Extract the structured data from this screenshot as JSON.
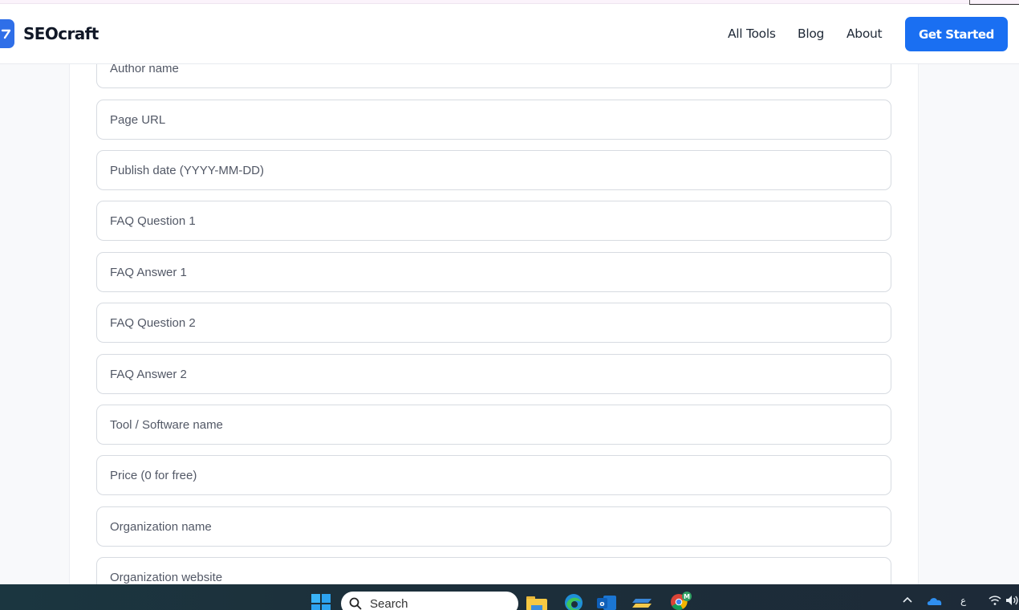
{
  "header": {
    "brand": "SEOcraft",
    "nav": [
      "All Tools",
      "Blog",
      "About"
    ],
    "cta_label": "Get Started"
  },
  "form": {
    "placeholders": [
      "Author name",
      "Page URL",
      "Publish date (YYYY-MM-DD)",
      "FAQ Question 1",
      "FAQ Answer 1",
      "FAQ Question 2",
      "FAQ Answer 2",
      "Tool / Software name",
      "Price (0 for free)",
      "Organization name",
      "Organization website"
    ]
  },
  "taskbar": {
    "search_placeholder": "Search",
    "chrome_badge": "M",
    "apps": [
      "start-icon",
      "search-icon",
      "file-explorer-icon",
      "edge-icon",
      "outlook-icon",
      "stickies-icon",
      "chrome-icon"
    ],
    "tray": [
      "chevron-up-icon",
      "onedrive-icon",
      "ع",
      "wifi-icon",
      "volume-icon"
    ]
  },
  "colors": {
    "accent": "#1a6ff2",
    "field_border": "#d7dbe1",
    "placeholder_text": "#525866",
    "taskbar_bg": "#1c2f3a"
  }
}
